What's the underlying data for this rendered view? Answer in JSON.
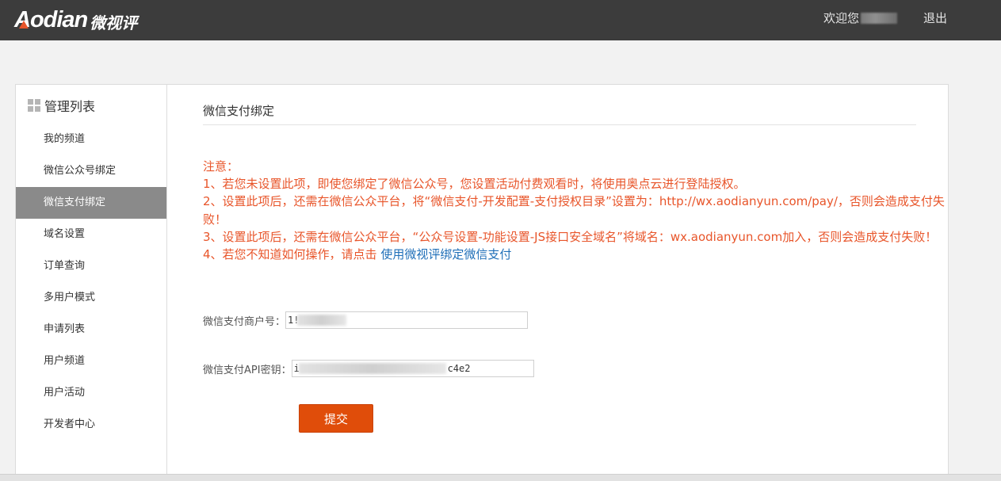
{
  "header": {
    "logo_latin": "Aodian",
    "logo_cn": "微视评",
    "welcome_label": "欢迎您",
    "logout_label": "退出"
  },
  "sidebar": {
    "title": "管理列表",
    "items": [
      {
        "label": "我的频道"
      },
      {
        "label": "微信公众号绑定"
      },
      {
        "label": "微信支付绑定",
        "active": true
      },
      {
        "label": "域名设置"
      },
      {
        "label": "订单查询"
      },
      {
        "label": "多用户模式"
      },
      {
        "label": "申请列表"
      },
      {
        "label": "用户频道"
      },
      {
        "label": "用户活动"
      },
      {
        "label": "开发者中心"
      }
    ]
  },
  "main": {
    "title": "微信支付绑定",
    "notice": {
      "heading": "注意：",
      "line1": "1、若您未设置此项，即使您绑定了微信公众号，您设置活动付费观看时，将使用奥点云进行登陆授权。",
      "line2": "2、设置此项后，还需在微信公众平台，将“微信支付-开发配置-支付授权目录”设置为：http://wx.aodianyun.com/pay/，否则会造成支付失败！",
      "line3": "3、设置此项后，还需在微信公众平台，“公众号设置-功能设置-JS接口安全域名”将域名：wx.aodianyun.com加入，否则会造成支付失败！",
      "line4_prefix": "4、若您不知道如何操作，请点击 ",
      "line4_link": "使用微视评绑定微信支付"
    },
    "form": {
      "merchant_label": "微信支付商户号：",
      "merchant_value_visible": "1!",
      "apikey_label": "微信支付API密钥：",
      "apikey_value_visible_start": "i",
      "apikey_value_visible_end": "c4e2",
      "submit_label": "提交"
    }
  },
  "colors": {
    "topbar": "#3c3c3c",
    "accent": "#e8552a",
    "button": "#e04d0a",
    "link": "#1f6fb8",
    "nav_active": "#8a8a8a"
  }
}
